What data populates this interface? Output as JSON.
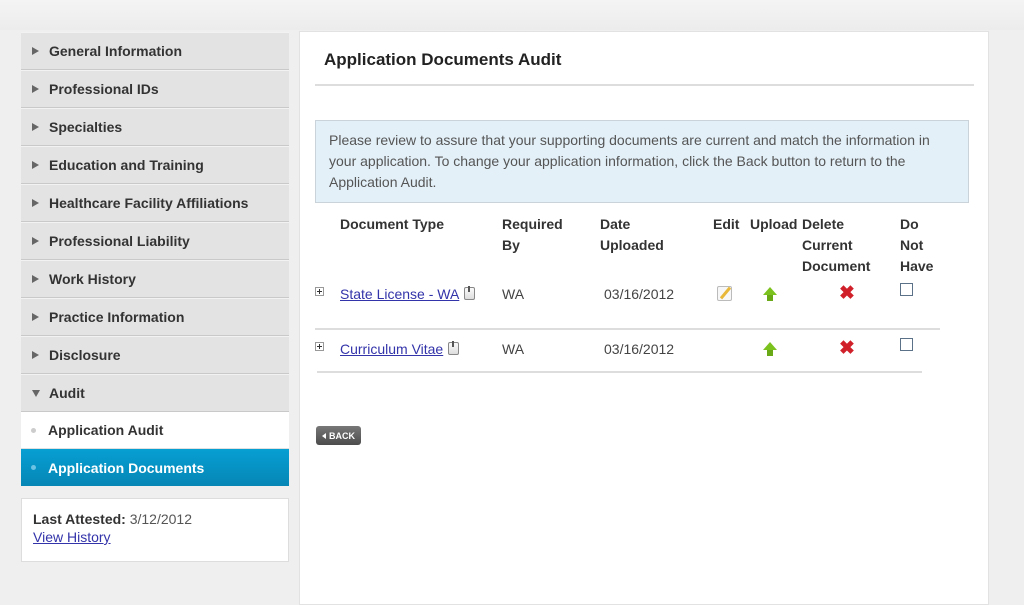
{
  "sidebar": {
    "items": [
      {
        "label": "General Information",
        "expanded": false
      },
      {
        "label": "Professional IDs",
        "expanded": false
      },
      {
        "label": "Specialties",
        "expanded": false
      },
      {
        "label": "Education and Training",
        "expanded": false
      },
      {
        "label": "Healthcare Facility Affiliations",
        "expanded": false
      },
      {
        "label": "Professional Liability",
        "expanded": false
      },
      {
        "label": "Work History",
        "expanded": false
      },
      {
        "label": "Practice Information",
        "expanded": false
      },
      {
        "label": "Disclosure",
        "expanded": false
      },
      {
        "label": "Audit",
        "expanded": true
      }
    ],
    "sub_items": [
      {
        "label": "Application Audit",
        "active": false
      },
      {
        "label": "Application Documents",
        "active": true
      }
    ],
    "attest": {
      "label": "Last Attested:",
      "value": "3/12/2012",
      "history_link": "View History"
    }
  },
  "main": {
    "title": "Application Documents Audit",
    "info_text": "Please review to assure that your supporting documents are current and match the information in your application. To change your application information, click the Back button to return to the Application Audit.",
    "table": {
      "headers": {
        "doc_type": "Document Type",
        "required_by_1": "Required",
        "required_by_2": "By",
        "date_1": "Date",
        "date_2": "Uploaded",
        "edit": "Edit",
        "upload": "Upload",
        "delete_1": "Delete",
        "delete_2": "Current",
        "delete_3": "Document",
        "dnh_1": "Do",
        "dnh_2": "Not",
        "dnh_3": "Have"
      },
      "rows": [
        {
          "doc_type": "State License - WA",
          "required_by": "WA",
          "date_uploaded": "03/16/2012",
          "editable": true,
          "do_not_have": false
        },
        {
          "doc_type": "Curriculum Vitae",
          "required_by": "WA",
          "date_uploaded": "03/16/2012",
          "editable": false,
          "do_not_have": false
        }
      ]
    },
    "back_label": "BACK"
  },
  "icons": {
    "expand": "plus-box-icon",
    "document": "document-icon",
    "edit": "pencil-edit-icon",
    "upload": "green-up-arrow-icon",
    "delete": "red-x-icon",
    "delete_glyph": "✖"
  },
  "colors": {
    "active_nav": "#079fd3",
    "info_bg": "#e3f0f8",
    "link": "#3333aa",
    "delete": "#d0202a",
    "upload": "#7cc21e"
  }
}
